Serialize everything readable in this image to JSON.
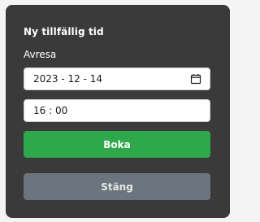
{
  "dialog": {
    "title": "Ny tillfällig tid",
    "date_label": "Avresa",
    "date_value": "2023 - 12 - 14",
    "time_value": "16 : 00",
    "book_label": "Boka",
    "close_label": "Stäng"
  },
  "icons": {
    "calendar": "calendar-icon"
  },
  "colors": {
    "panel_bg": "#3a3a3a",
    "book_button": "#2ea84a",
    "close_button": "#6c757d"
  }
}
